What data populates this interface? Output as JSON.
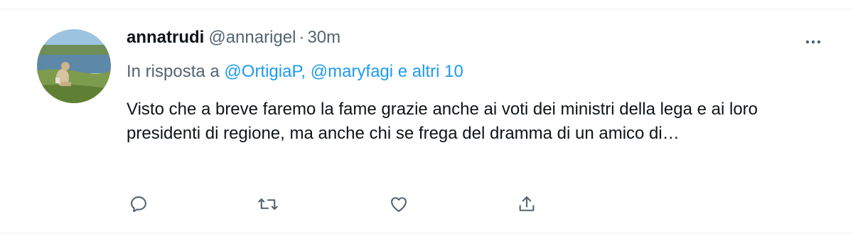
{
  "tweet": {
    "author_name": "annatrudi",
    "author_handle": "@annarigel",
    "separator": "·",
    "timestamp": "30m",
    "reply_prefix": "In risposta a",
    "reply_mention_1": "@OrtigiaP,",
    "reply_mention_2": "@maryfagi",
    "reply_suffix": "e altri 10",
    "text": "Visto che a breve faremo la fame grazie anche ai voti dei ministri della lega e ai loro presidenti di regione, ma anche chi se frega del dramma di un amico di…"
  },
  "icons": {
    "more": "more-dots-icon",
    "reply": "reply-icon",
    "retweet": "retweet-icon",
    "like": "heart-icon",
    "share": "share-icon"
  },
  "colors": {
    "link": "#1d9bf0",
    "secondary_text": "#536471",
    "icon": "#536471"
  }
}
